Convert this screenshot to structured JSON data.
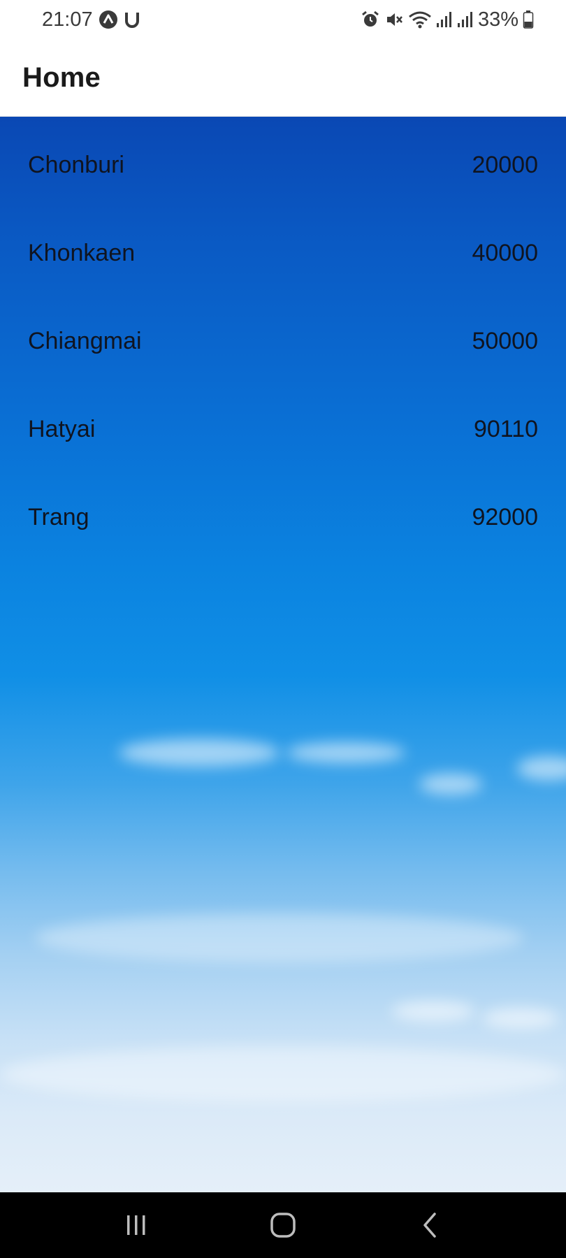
{
  "status_bar": {
    "time": "21:07",
    "battery_percent": "33%",
    "icons": [
      "app-a-icon",
      "app-u-icon",
      "alarm-icon",
      "mute-icon",
      "wifi-icon",
      "signal-icon",
      "signal-icon",
      "battery-icon"
    ]
  },
  "app_bar": {
    "title": "Home"
  },
  "cities": [
    {
      "name": "Chonburi",
      "code": "20000"
    },
    {
      "name": "Khonkaen",
      "code": "40000"
    },
    {
      "name": "Chiangmai",
      "code": "50000"
    },
    {
      "name": "Hatyai",
      "code": "90110"
    },
    {
      "name": "Trang",
      "code": "92000"
    }
  ],
  "nav_bar": {
    "buttons": [
      "recent-apps-icon",
      "home-icon",
      "back-icon"
    ]
  },
  "colors": {
    "sky_top": "#0a48b4",
    "sky_bottom": "#e5eff9",
    "text": "#0f1420"
  }
}
